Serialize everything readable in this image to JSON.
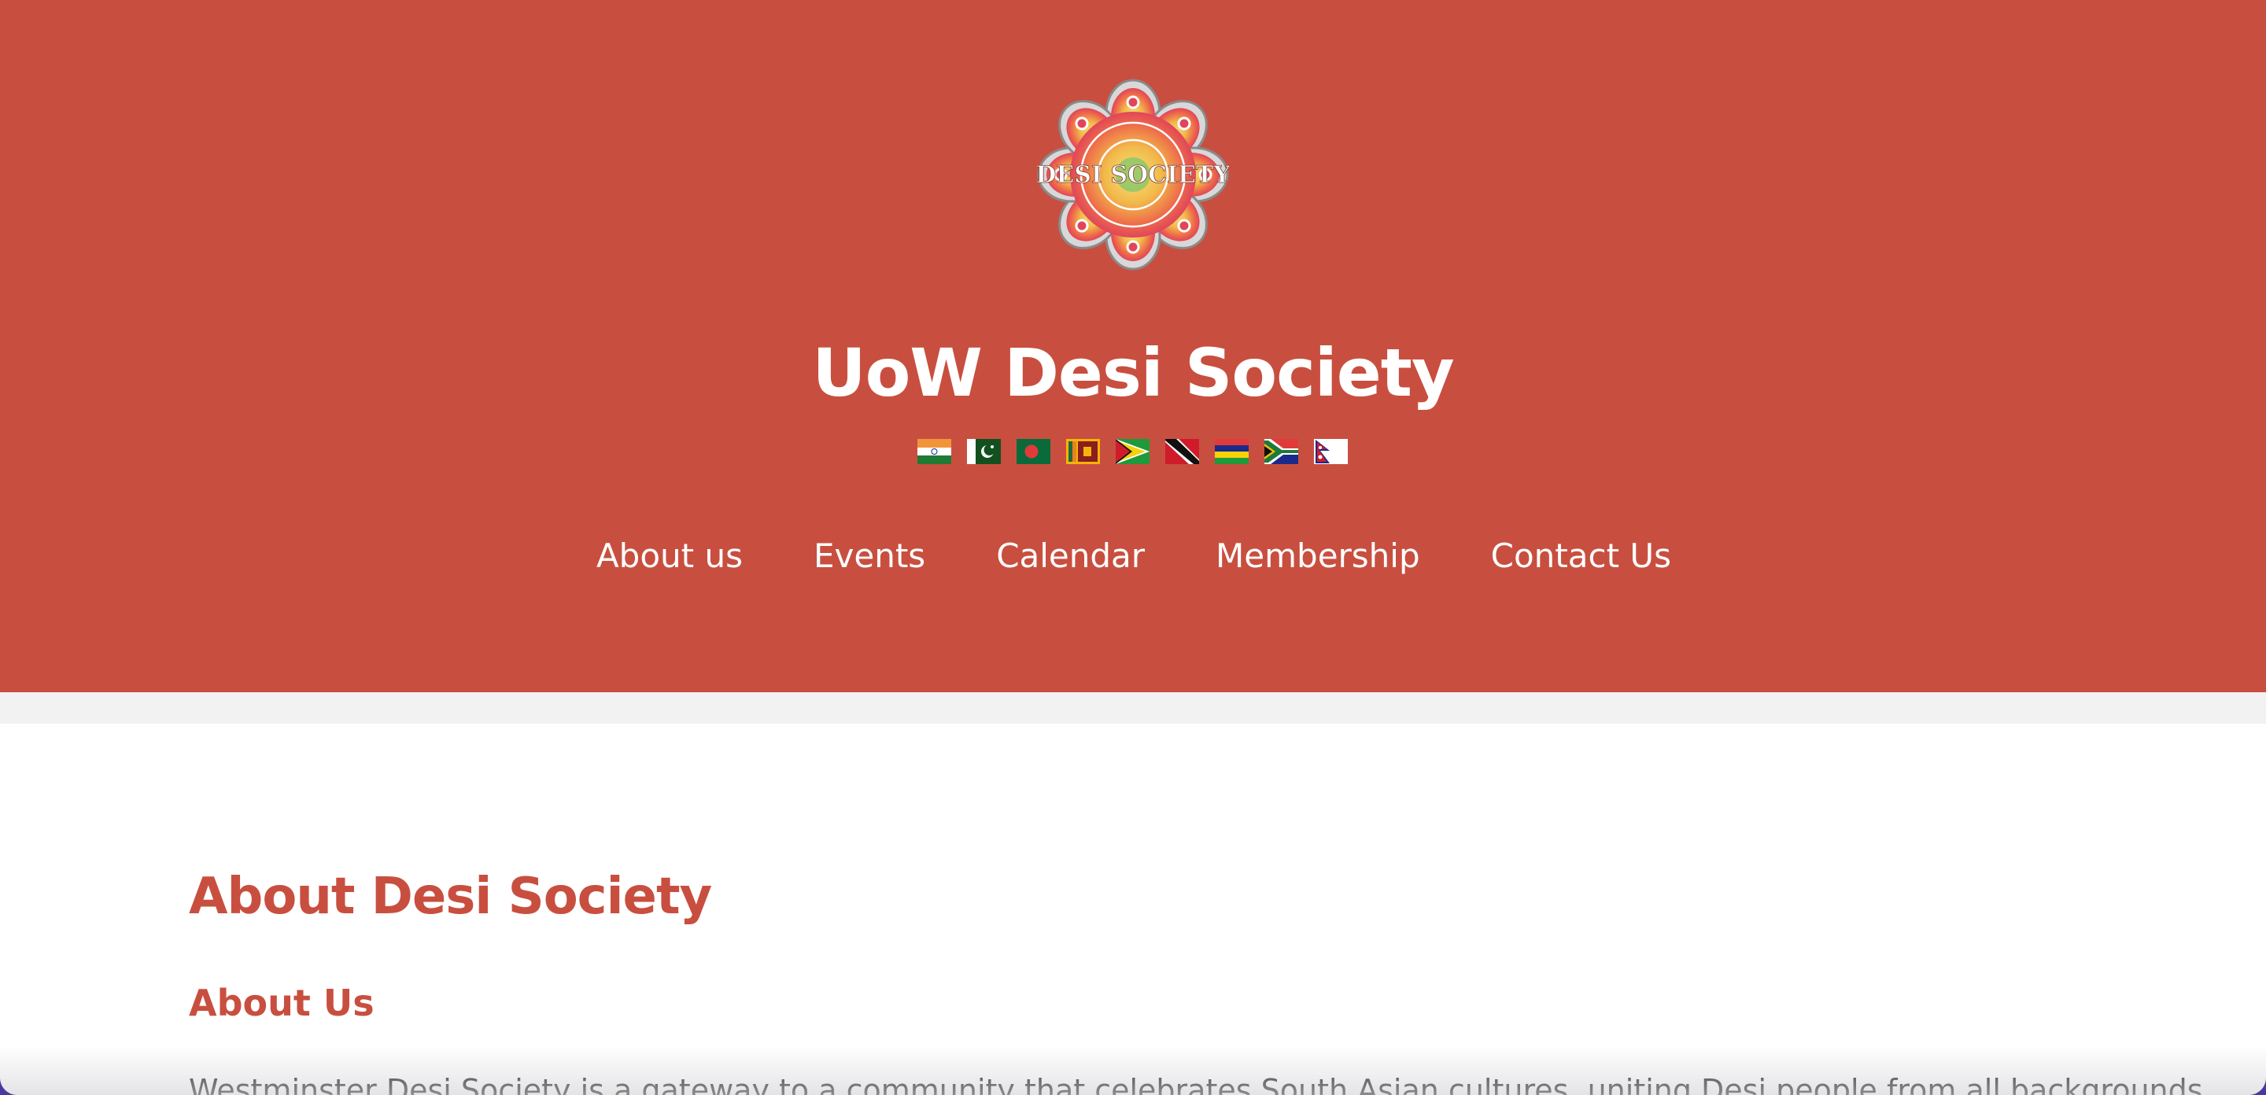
{
  "colors": {
    "brand": "#c84f3f",
    "header_text": "#ffffff",
    "band": "#f2f2f2",
    "body_text": "#222222"
  },
  "logo": {
    "icon": "desi-society-mandala-logo",
    "text": "DESI SOCIETY"
  },
  "site_title": "UoW Desi Society",
  "flags": [
    {
      "icon": "india-flag-icon"
    },
    {
      "icon": "pakistan-flag-icon"
    },
    {
      "icon": "bangladesh-flag-icon"
    },
    {
      "icon": "sri-lanka-flag-icon"
    },
    {
      "icon": "guyana-flag-icon"
    },
    {
      "icon": "trinidad-tobago-flag-icon"
    },
    {
      "icon": "mauritius-flag-icon"
    },
    {
      "icon": "south-africa-flag-icon"
    },
    {
      "icon": "nepal-flag-icon"
    }
  ],
  "nav": {
    "items": [
      "About us",
      "Events",
      "Calendar",
      "Membership",
      "Contact Us"
    ]
  },
  "main": {
    "heading": "About Desi Society",
    "subheading": "About Us",
    "paragraph": "Westminster Desi Society is a gateway to a community that celebrates South Asian cultures, uniting Desi people from all backgrounds"
  }
}
